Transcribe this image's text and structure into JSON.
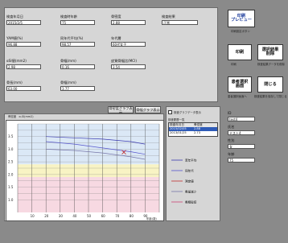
{
  "window": {
    "title": "Growth measurement entry"
  },
  "form": {
    "f1": {
      "label": "検査年月日",
      "value": "2015/2/5"
    },
    "f2": {
      "label": "検査時年齢",
      "value": "75"
    },
    "f3": {
      "label": "骨密度",
      "value": "2.88"
    },
    "f4": {
      "label": "検査結果",
      "value": "正常"
    },
    "f5": {
      "label": "YAM値(%)",
      "value": "96.88"
    },
    "f6": {
      "label": "同年代平均(%)",
      "value": "98.57"
    },
    "f7": {
      "label": "年代層",
      "value": "60代女子"
    },
    "f8": {
      "label": "αSI値(mm2)",
      "value": "2.98"
    },
    "f9": {
      "label": "骨幅(mm)",
      "value": "0.16"
    },
    "f10": {
      "label": "皮質骨幅比(MCI)",
      "value": "3.54"
    },
    "f11": {
      "label": "骨長(mm)",
      "value": "63.00"
    },
    "f12": {
      "label": "骨幅(mm)",
      "value": "3.77"
    }
  },
  "buttons": {
    "print_top": "印刷\nプレビュー",
    "print": "印刷",
    "select_result": "選択結果\n削除",
    "delete_select": "患者選択\n画面",
    "close": "閉じる",
    "graph_left": "骨密度グラフ表示",
    "graph_right": "骨幅グラフ表示"
  },
  "side": {
    "print_label": "印刷設定ボタン",
    "note1": "印刷",
    "note2": "検査結果データを削除",
    "note3": "患者選択画面へ",
    "note4": "検査結果を保存して閉じる"
  },
  "info": {
    "id_label": "ID",
    "id_value": "test4",
    "name_label": "氏名",
    "name_value": "テスト4",
    "sex_label": "性別",
    "sex_value": "女",
    "age_label": "年齢",
    "age_value": "75"
  },
  "list": {
    "checkbox_label": "検査グラフデータ表示",
    "title": "検査履歴一覧",
    "headers": [
      "検査年月日",
      "骨密度"
    ],
    "rows": [
      [
        "2015/02/05",
        "2.88"
      ],
      [
        "2013/01/25",
        "2.73"
      ]
    ]
  },
  "chart": {
    "title": "骨密度　α-SI(mm2)",
    "unit": "mm2",
    "y_ticks": [
      "3.5",
      "3.0",
      "2.5",
      "2.0",
      "1.5",
      "1.0"
    ],
    "x_ticks": [
      "10",
      "20",
      "30",
      "40",
      "50",
      "60",
      "70",
      "80",
      "90"
    ],
    "x_unit": "年齢(歳)",
    "legend": [
      "若年平均",
      "同年代",
      "測定値",
      "骨量減少",
      "骨粗鬆症"
    ],
    "colors": {
      "band_blue": "#dbe8f6",
      "band_yellow": "#f8f3c4",
      "band_pink": "#f7d9e2",
      "line": "#3a3ab0",
      "marker": "#c03030"
    }
  },
  "chart_data": {
    "type": "line",
    "y_ticks": [
      3.5,
      3.0,
      2.5,
      2.0,
      1.5,
      1.0
    ],
    "x_ticks": [
      10,
      20,
      30,
      40,
      50,
      60,
      70,
      80,
      90
    ],
    "ylim": [
      0.5,
      4.0
    ],
    "xlim": [
      0,
      100
    ],
    "series": [
      {
        "name": "若年平均",
        "x": [
          20,
          40,
          60,
          80,
          90
        ],
        "y": [
          3.5,
          3.45,
          3.4,
          3.3,
          3.2
        ]
      },
      {
        "name": "同年代",
        "x": [
          20,
          40,
          60,
          80,
          90
        ],
        "y": [
          3.3,
          3.2,
          3.05,
          2.9,
          2.8
        ]
      },
      {
        "name": "骨量減少",
        "x": [
          20,
          40,
          60,
          80,
          90
        ],
        "y": [
          3.0,
          2.95,
          2.85,
          2.7,
          2.6
        ]
      }
    ],
    "points": [
      {
        "x": 75,
        "y": 2.88
      }
    ]
  }
}
